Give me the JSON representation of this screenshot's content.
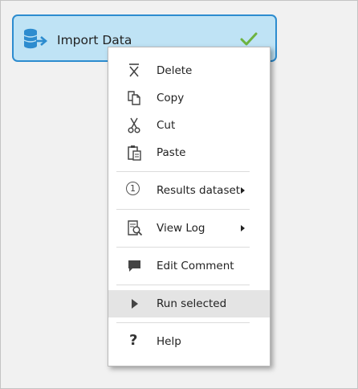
{
  "module": {
    "title": "Import Data",
    "status_icon": "check-icon",
    "colors": {
      "fill": "#bfe3f5",
      "border": "#2d8ccf",
      "check": "#6db33f"
    }
  },
  "context_menu": {
    "items": [
      {
        "label": "Delete",
        "icon": "delete-icon"
      },
      {
        "label": "Copy",
        "icon": "copy-icon"
      },
      {
        "label": "Cut",
        "icon": "cut-icon"
      },
      {
        "label": "Paste",
        "icon": "paste-icon"
      },
      {
        "label": "Results dataset",
        "icon": "output-port-1-icon",
        "submenu": true
      },
      {
        "label": "View Log",
        "icon": "view-log-icon",
        "submenu": true
      },
      {
        "label": "Edit Comment",
        "icon": "comment-icon"
      },
      {
        "label": "Run selected",
        "icon": "run-icon",
        "highlighted": true
      },
      {
        "label": "Help",
        "icon": "help-icon"
      }
    ],
    "results_dataset_badge": "1",
    "help_glyph": "?",
    "highlight_color": "#e4e4e4"
  }
}
